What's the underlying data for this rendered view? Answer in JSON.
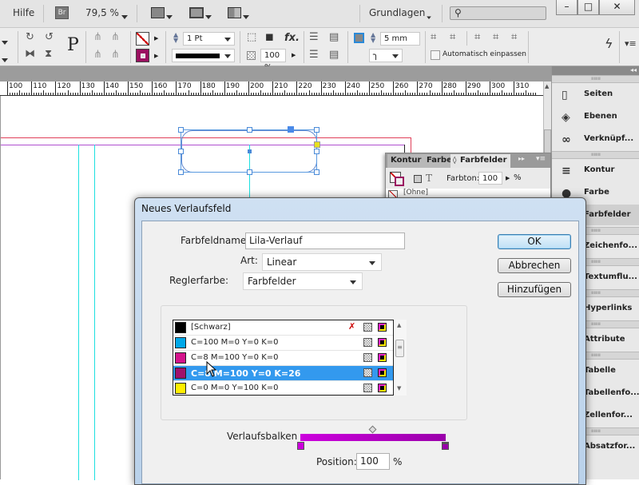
{
  "menubar": {
    "help_label": "Hilfe",
    "bridge_label": "Br",
    "zoom_value": "79,5 %",
    "workspace_label": "Grundlagen",
    "search_placeholder": ""
  },
  "window_controls": {
    "minimize": "–",
    "maximize": "□",
    "close": "✕"
  },
  "control_bar": {
    "stroke_weight": "1 Pt",
    "opacity": "100 %",
    "corner_size": "5 mm",
    "auto_fit_label": "Automatisch einpassen",
    "auto_fit_checked": false
  },
  "ruler": {
    "labels": [
      "100",
      "110",
      "120",
      "130",
      "140",
      "150",
      "160",
      "170",
      "180",
      "190",
      "200",
      "210",
      "220",
      "230",
      "240",
      "250",
      "260",
      "270",
      "280",
      "290",
      "300",
      "310"
    ]
  },
  "dock": {
    "groups": [
      {
        "items": [
          {
            "label": "Seiten",
            "icon": "pages-icon"
          },
          {
            "label": "Ebenen",
            "icon": "layers-icon"
          },
          {
            "label": "Verknüpf...",
            "icon": "links-icon"
          }
        ]
      },
      {
        "items": [
          {
            "label": "Kontur",
            "icon": "stroke-icon"
          },
          {
            "label": "Farbe",
            "icon": "color-icon"
          },
          {
            "label": "Farbfelder",
            "icon": "swatches-icon"
          }
        ]
      },
      {
        "items": [
          {
            "label": "Zeichenfo...",
            "icon": "char-styles-icon"
          }
        ]
      },
      {
        "items": [
          {
            "label": "Textumflu...",
            "icon": "text-wrap-icon"
          }
        ]
      },
      {
        "items": [
          {
            "label": "Hyperlinks",
            "icon": "hyperlinks-icon"
          }
        ]
      },
      {
        "items": [
          {
            "label": "Attribute",
            "icon": "attributes-icon"
          }
        ]
      },
      {
        "items": [
          {
            "label": "Tabelle",
            "icon": "table-icon"
          },
          {
            "label": "Tabellenfo...",
            "icon": "table-styles-icon"
          },
          {
            "label": "Zellenfor...",
            "icon": "cell-styles-icon"
          }
        ]
      },
      {
        "items": [
          {
            "label": "Absatzfor...",
            "icon": "para-styles-icon"
          }
        ]
      }
    ]
  },
  "swatches_panel": {
    "tabs": [
      "Kontur",
      "Farbe",
      "Farbfelder"
    ],
    "active_tab": "Farbfelder",
    "tint_label": "Farbton:",
    "tint_value": "100",
    "tint_unit": "%",
    "first_row": "[Ohne]"
  },
  "dialog": {
    "title": "Neues Verlaufsfeld",
    "name_label": "Farbfeldname:",
    "name_value": "Lila-Verlauf",
    "type_label": "Art:",
    "type_value": "Linear",
    "stop_color_label": "Reglerfarbe:",
    "stop_color_value": "Farbfelder",
    "swatches": [
      {
        "name": "[Schwarz]",
        "color": "#000000",
        "selected": false
      },
      {
        "name": "C=100 M=0 Y=0 K=0",
        "color": "#00a8e8",
        "selected": false
      },
      {
        "name": "C=8 M=100 Y=0 K=0",
        "color": "#d4148c",
        "selected": false
      },
      {
        "name": "C=8 M=100 Y=0 K=26",
        "color": "#a0106c",
        "selected": true
      },
      {
        "name": "C=0 M=0 Y=100 K=0",
        "color": "#ffee00",
        "selected": false
      }
    ],
    "gradient_label": "Verlaufsbalken",
    "gradient": {
      "start_color": "#cc00dd",
      "end_color": "#9a00aa",
      "midpoint_percent": 50
    },
    "position_label": "Position:",
    "position_value": "100",
    "position_unit": "%",
    "buttons": {
      "ok": "OK",
      "cancel": "Abbrechen",
      "add": "Hinzufügen"
    }
  }
}
